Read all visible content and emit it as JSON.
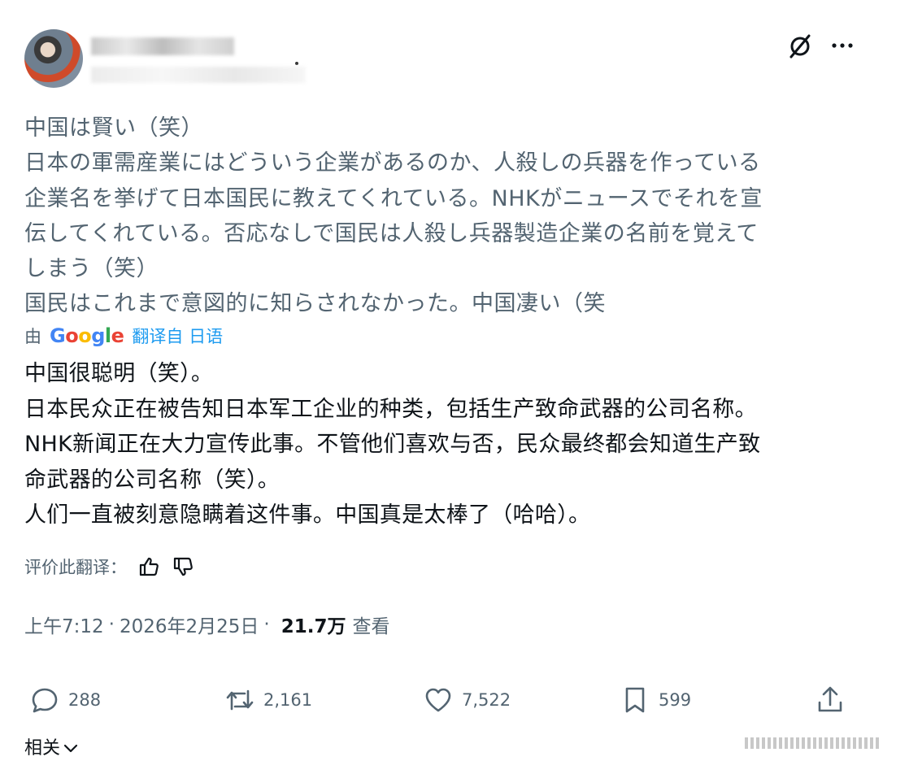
{
  "japanese_text": "中国は賢い（笑）\n日本の軍需産業にはどういう企業があるのか、人殺しの兵器を作っている\n企業名を挙げて日本国民に教えてくれている。NHKがニュースでそれを宣\n伝してくれている。否応なしで国民は人殺し兵器製造企業の名前を覚えて\nしまう（笑）\n国民はこれまで意図的に知らされなかった。中国凄い（笑",
  "translation": {
    "by_label": "由",
    "google": "Google",
    "link": "翻译自 日语"
  },
  "translated_text": "中国很聪明（笑）。\n日本民众正在被告知日本军工企业的种类，包括生产致命武器的公司名称。\nNHK新闻正在大力宣传此事。不管他们喜欢与否，民众最终都会知道生产致\n命武器的公司名称（笑）。\n人们一直被刻意隐瞒着这件事。中国真是太棒了（哈哈）。",
  "rating": {
    "label": "评价此翻译："
  },
  "meta": {
    "time": "上午7:12",
    "separator": "·",
    "date": "2026年2月25日",
    "views_count": "21.7万",
    "views_label": "查看"
  },
  "actions": {
    "replies": "288",
    "reposts": "2,161",
    "likes": "7,522",
    "bookmarks": "599"
  },
  "related_label": "相关",
  "icons": {
    "grok": "grok-icon",
    "more": "more-icon",
    "thumbs_up": "thumbs-up-icon",
    "thumbs_down": "thumbs-down-icon",
    "reply": "reply-icon",
    "repost": "repost-icon",
    "like": "heart-icon",
    "bookmark": "bookmark-icon",
    "share": "share-icon",
    "chevron": "chevron-down-icon"
  }
}
